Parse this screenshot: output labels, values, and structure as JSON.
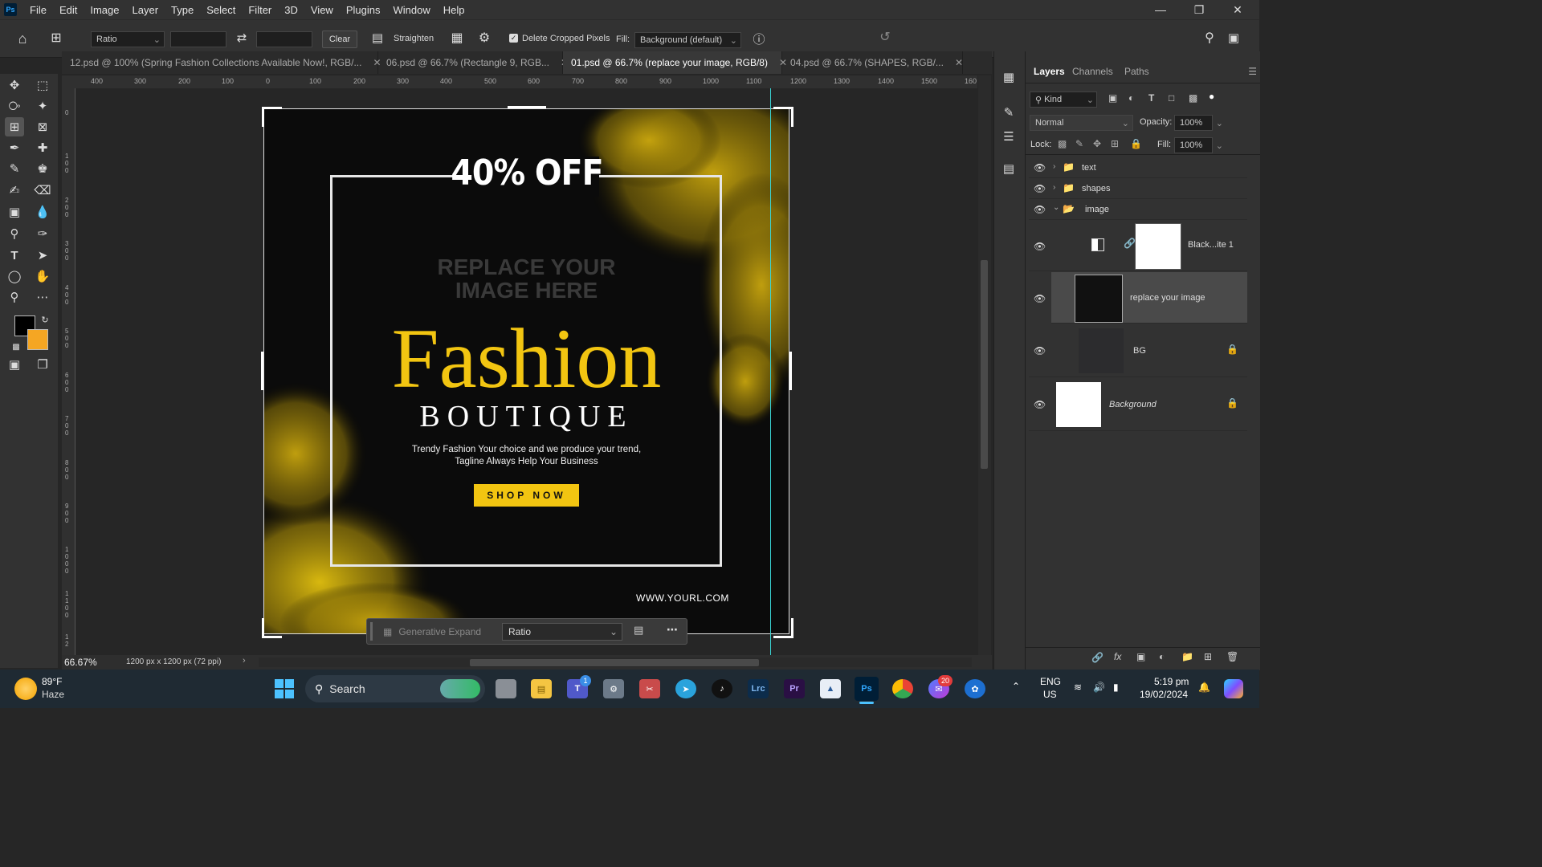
{
  "app": {
    "logo": "Ps",
    "menu": [
      "File",
      "Edit",
      "Image",
      "Layer",
      "Type",
      "Select",
      "Filter",
      "3D",
      "View",
      "Plugins",
      "Window",
      "Help"
    ]
  },
  "options_bar": {
    "ratio": "Ratio",
    "clear": "Clear",
    "straighten": "Straighten",
    "delete_cropped_label": "Delete Cropped Pixels",
    "delete_cropped_checked": true,
    "fill_label": "Fill:",
    "fill_value": "Background (default)"
  },
  "tabs": [
    {
      "label": "12.psd @ 100% (Spring Fashion Collections Available Now!, RGB/...",
      "active": false
    },
    {
      "label": "06.psd @ 66.7% (Rectangle 9, RGB...",
      "active": false
    },
    {
      "label": "01.psd @ 66.7% (replace your image, RGB/8)",
      "active": true
    },
    {
      "label": "04.psd @ 66.7% (SHAPES, RGB/...",
      "active": false
    }
  ],
  "ruler_h_labels": [
    "400",
    "300",
    "200",
    "100",
    "0",
    "100",
    "200",
    "300",
    "400",
    "500",
    "600",
    "700",
    "800",
    "900",
    "1000",
    "1100",
    "1200",
    "1300",
    "1400",
    "1500",
    "160"
  ],
  "ruler_v_labels": [
    "0",
    "1 0 0",
    "2 0 0",
    "3 0 0",
    "4 0 0",
    "5 0 0",
    "6 0 0",
    "7 0 0",
    "8 0 0",
    "9 0 0",
    "1 0 0 0",
    "1 1 0 0",
    "1 2"
  ],
  "design": {
    "discount": "40% OFF",
    "placeholder_line1": "REPLACE YOUR",
    "placeholder_line2": "IMAGE HERE",
    "title": "Fashion",
    "subtitle": "BOUTIQUE",
    "tagline_line1": "Trendy Fashion Your choice and we produce your trend,",
    "tagline_line2": "Tagline Always Help Your Business",
    "cta": "SHOP NOW",
    "url": "WWW.YOURL.COM",
    "colors": {
      "accent": "#f2c511",
      "background": "#0b0b0b",
      "text": "#ffffff"
    }
  },
  "context_bar": {
    "generative_expand": "Generative Expand",
    "ratio": "Ratio"
  },
  "status": {
    "zoom": "66.67%",
    "doc_size": "1200 px x 1200 px (72 ppi)"
  },
  "layers_panel": {
    "tabs": [
      "Layers",
      "Channels",
      "Paths"
    ],
    "kind": "Kind",
    "blend_mode": "Normal",
    "opacity_label": "Opacity:",
    "opacity": "100%",
    "lock_label": "Lock:",
    "fill_label": "Fill:",
    "fill": "100%",
    "layers": [
      {
        "name": "text",
        "type": "group"
      },
      {
        "name": "shapes",
        "type": "group"
      },
      {
        "name": "image",
        "type": "group-open"
      },
      {
        "name": "Black...ite 1",
        "type": "adjustment"
      },
      {
        "name": "replace your image",
        "type": "smart",
        "selected": true
      },
      {
        "name": "BG",
        "type": "locked"
      },
      {
        "name": "Background",
        "type": "background"
      }
    ]
  },
  "taskbar": {
    "weather_temp": "89°F",
    "weather_desc": "Haze",
    "search": "Search",
    "lang1": "ENG",
    "lang2": "US",
    "time": "5:19 pm",
    "date": "19/02/2024",
    "teams_badge": "1",
    "messenger_badge": "20",
    "app_lrc": "Lrc",
    "app_pr": "Pr",
    "app_ps": "Ps"
  }
}
